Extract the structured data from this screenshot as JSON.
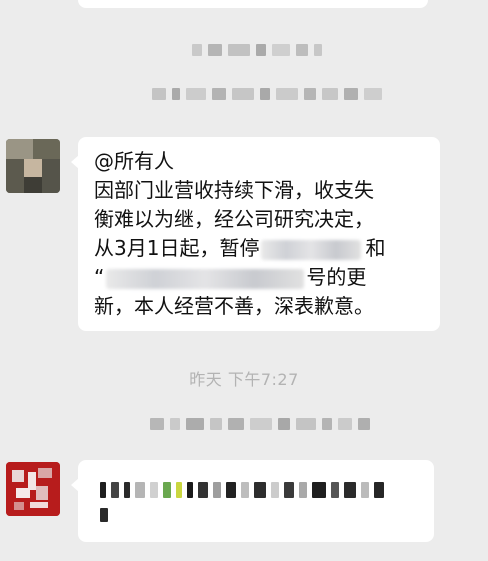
{
  "messages": [
    {
      "sender": "group-member",
      "lines": [
        "@所有人",
        "因部门业营收持续下滑，收支失",
        "衡难以为继，经公司研究决定，",
        "从3月1日起，暂停",
        "和",
        "“",
        "号的更",
        "新，本人经营不善，深表歉意。"
      ]
    }
  ],
  "timestamp": "昨天 下午7:27",
  "colors": {
    "background": "#ececec",
    "bubble": "#ffffff",
    "text": "#111111",
    "timestamp": "#b3b3b3",
    "avatar_2": "#b71c1c"
  }
}
